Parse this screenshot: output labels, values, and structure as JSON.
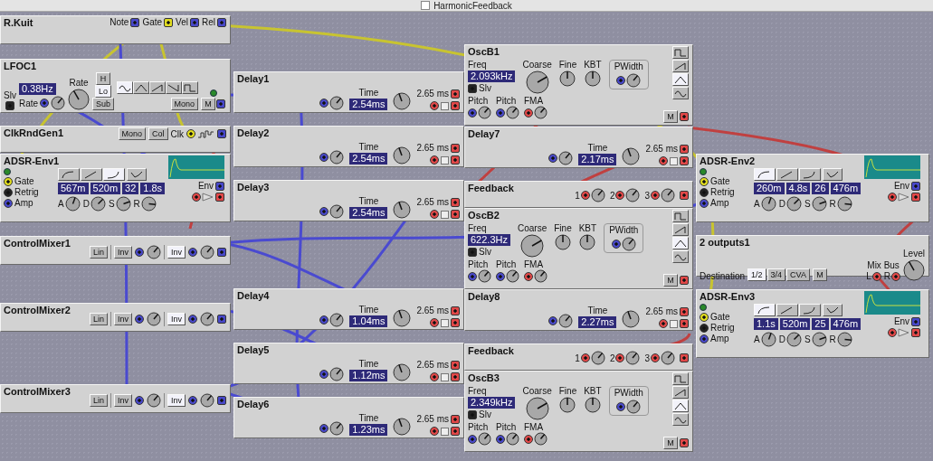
{
  "window": {
    "title": "HarmonicFeedback",
    "checked": false
  },
  "modules": [
    {
      "kind": "keyboard",
      "title": "R.Kuit",
      "ports": [
        "Note",
        "Gate",
        "Vel",
        "Rel"
      ]
    },
    {
      "kind": "lfo",
      "title": "LFOC1",
      "slave_label": "Slv",
      "rate_label": "Rate",
      "rate_value": "0.38Hz",
      "knob_label": "Rate",
      "ranges": [
        {
          "label": "H",
          "selected": false
        },
        {
          "label": "Lo",
          "selected": true
        },
        {
          "label": "Sub",
          "selected": false
        }
      ],
      "waveforms": [
        {
          "kind": "sine",
          "selected": true
        },
        {
          "kind": "triangle",
          "selected": false
        },
        {
          "kind": "saw",
          "selected": false
        },
        {
          "kind": "saw_down",
          "selected": false
        },
        {
          "kind": "square",
          "selected": false
        }
      ],
      "mono": "Mono",
      "mute": "M"
    },
    {
      "kind": "clock",
      "title": "ClkRndGen1",
      "buttons": [
        "Mono",
        "Col"
      ],
      "clock_label": "Clk"
    },
    {
      "kind": "adsr",
      "title": "ADSR-Env1",
      "inputs": [
        "Gate",
        "Retrig",
        "Amp"
      ],
      "shapes": [
        {
          "kind": "log",
          "selected": false
        },
        {
          "kind": "lin",
          "selected": false
        },
        {
          "kind": "exp",
          "selected": true
        }
      ],
      "values": [
        "567m",
        "520m",
        "32",
        "1.8s"
      ],
      "knobs": [
        "A",
        "D",
        "S",
        "R"
      ],
      "env_label": "Env"
    },
    {
      "kind": "mixer",
      "title": "ControlMixer1",
      "buttons": [
        {
          "label": "Lin",
          "selected": false
        },
        {
          "label": "Inv",
          "selected": false
        },
        {
          "label": "Inv",
          "selected": true
        }
      ]
    },
    {
      "kind": "mixer",
      "title": "ControlMixer2",
      "buttons": [
        {
          "label": "Lin",
          "selected": false
        },
        {
          "label": "Inv",
          "selected": false
        },
        {
          "label": "Inv",
          "selected": true
        }
      ]
    },
    {
      "kind": "mixer",
      "title": "ControlMixer3",
      "buttons": [
        {
          "label": "Lin",
          "selected": false
        },
        {
          "label": "Inv",
          "selected": false
        },
        {
          "label": "Inv",
          "selected": true
        }
      ]
    },
    {
      "kind": "delay",
      "title": "Delay1",
      "time_label": "Time",
      "time_value": "2.54ms",
      "range_label": "2.65 ms"
    },
    {
      "kind": "delay",
      "title": "Delay2",
      "time_label": "Time",
      "time_value": "2.54ms",
      "range_label": "2.65 ms"
    },
    {
      "kind": "delay",
      "title": "Delay3",
      "time_label": "Time",
      "time_value": "2.54ms",
      "range_label": "2.65 ms"
    },
    {
      "kind": "delay",
      "title": "Delay4",
      "time_label": "Time",
      "time_value": "1.04ms",
      "range_label": "2.65 ms"
    },
    {
      "kind": "delay",
      "title": "Delay5",
      "time_label": "Time",
      "time_value": "1.12ms",
      "range_label": "2.65 ms"
    },
    {
      "kind": "delay",
      "title": "Delay6",
      "time_label": "Time",
      "time_value": "1.23ms",
      "range_label": "2.65 ms"
    },
    {
      "kind": "osc",
      "title": "OscB1",
      "freq_label": "Freq",
      "freq_value": "2.093kHz",
      "slave_label": "Slv",
      "knobs": [
        "Coarse",
        "Fine",
        "KBT"
      ],
      "pwidth_label": "PWidth",
      "inputs": [
        "Pitch",
        "Pitch",
        "FMA"
      ],
      "waveforms": [
        {
          "kind": "square",
          "selected": false
        },
        {
          "kind": "saw",
          "selected": false
        },
        {
          "kind": "triangle",
          "selected": true
        },
        {
          "kind": "sine",
          "selected": false
        }
      ],
      "mute": "M"
    },
    {
      "kind": "delay",
      "title": "Delay7",
      "time_label": "Time",
      "time_value": "2.17ms",
      "range_label": "2.65 ms"
    },
    {
      "kind": "feedback",
      "title": "Feedback",
      "inputs": [
        "1",
        "2",
        "3"
      ]
    },
    {
      "kind": "osc",
      "title": "OscB2",
      "freq_label": "Freq",
      "freq_value": "622.3Hz",
      "slave_label": "Slv",
      "knobs": [
        "Coarse",
        "Fine",
        "KBT"
      ],
      "pwidth_label": "PWidth",
      "inputs": [
        "Pitch",
        "Pitch",
        "FMA"
      ],
      "waveforms": [
        {
          "kind": "square",
          "selected": false
        },
        {
          "kind": "saw",
          "selected": false
        },
        {
          "kind": "triangle",
          "selected": true
        },
        {
          "kind": "sine",
          "selected": false
        }
      ],
      "mute": "M"
    },
    {
      "kind": "delay",
      "title": "Delay8",
      "time_label": "Time",
      "time_value": "2.27ms",
      "range_label": "2.65 ms"
    },
    {
      "kind": "feedback",
      "title": "Feedback",
      "inputs": [
        "1",
        "2",
        "3"
      ]
    },
    {
      "kind": "osc",
      "title": "OscB3",
      "freq_label": "Freq",
      "freq_value": "2.349kHz",
      "slave_label": "Slv",
      "knobs": [
        "Coarse",
        "Fine",
        "KBT"
      ],
      "pwidth_label": "PWidth",
      "inputs": [
        "Pitch",
        "Pitch",
        "FMA"
      ],
      "waveforms": [
        {
          "kind": "square",
          "selected": false
        },
        {
          "kind": "saw",
          "selected": false
        },
        {
          "kind": "triangle",
          "selected": true
        },
        {
          "kind": "sine",
          "selected": false
        }
      ],
      "mute": "M"
    },
    {
      "kind": "adsr",
      "title": "ADSR-Env2",
      "inputs": [
        "Gate",
        "Retrig",
        "Amp"
      ],
      "shapes": [
        {
          "kind": "log",
          "selected": true
        },
        {
          "kind": "lin",
          "selected": false
        },
        {
          "kind": "exp",
          "selected": false
        }
      ],
      "values": [
        "260m",
        "4.8s",
        "26",
        "476m"
      ],
      "knobs": [
        "A",
        "D",
        "S",
        "R"
      ],
      "env_label": "Env"
    },
    {
      "kind": "output",
      "title": "2 outputs1",
      "destination_label": "Destination",
      "destinations": [
        {
          "label": "1/2",
          "selected": true
        },
        {
          "label": "3/4",
          "selected": false
        },
        {
          "label": "CVA",
          "selected": false
        }
      ],
      "mute": "M",
      "bus_label": "Mix Bus",
      "channels": [
        "L",
        "R"
      ],
      "level_label": "Level"
    },
    {
      "kind": "adsr",
      "title": "ADSR-Env3",
      "inputs": [
        "Gate",
        "Retrig",
        "Amp"
      ],
      "shapes": [
        {
          "kind": "log",
          "selected": true
        },
        {
          "kind": "lin",
          "selected": false
        },
        {
          "kind": "exp",
          "selected": false
        }
      ],
      "values": [
        "1.1s",
        "520m",
        "25",
        "476m"
      ],
      "knobs": [
        "A",
        "D",
        "S",
        "R"
      ],
      "env_label": "Env"
    }
  ]
}
